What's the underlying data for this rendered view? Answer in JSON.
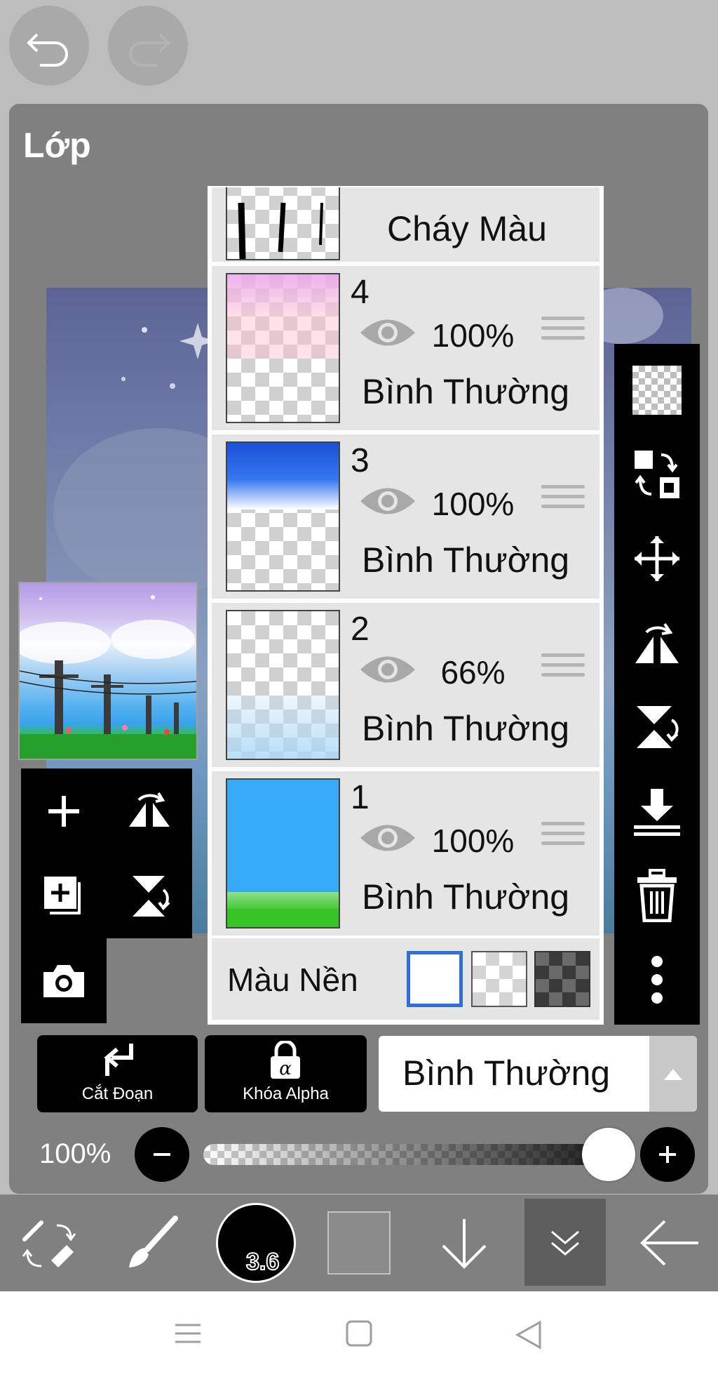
{
  "toolbar_top": {
    "undo_icon": "undo-icon",
    "redo_icon": "redo-icon"
  },
  "panel": {
    "title": "Lớp"
  },
  "layers": [
    {
      "number": "",
      "opacity": "",
      "blend": "Cháy Màu",
      "thumb": "black-strokes"
    },
    {
      "number": "4",
      "opacity": "100%",
      "blend": "Bình Thường",
      "thumb": "pink-fade"
    },
    {
      "number": "3",
      "opacity": "100%",
      "blend": "Bình Thường",
      "thumb": "blue-sky"
    },
    {
      "number": "2",
      "opacity": "66%",
      "blend": "Bình Thường",
      "thumb": "light-clouds"
    },
    {
      "number": "1",
      "opacity": "100%",
      "blend": "Bình Thường",
      "thumb": "blue-green"
    }
  ],
  "background": {
    "label": "Màu Nền",
    "options": [
      "white",
      "transparent",
      "dark"
    ],
    "selected": "white"
  },
  "actions": {
    "clip_label": "Cắt Đoạn",
    "alpha_label": "Khóa Alpha",
    "blend_mode": "Bình Thường"
  },
  "opacity": {
    "label": "100%",
    "value": 1.0
  },
  "brush": {
    "size": "3.6"
  },
  "colors": {
    "panel": "#808080",
    "selected_border": "#2f6fd8",
    "sky": "#36aaf5",
    "grass": "#35c424"
  }
}
